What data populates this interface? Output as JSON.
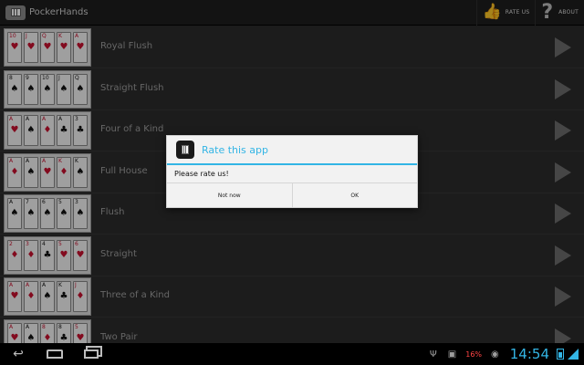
{
  "app": {
    "title": "PockerHands"
  },
  "actionbar": {
    "rate_label": "RATE US",
    "about_label": "ABOUT"
  },
  "hands": [
    {
      "label": "Royal Flush",
      "cards": [
        [
          "10",
          "♥",
          "red"
        ],
        [
          "J",
          "♥",
          "red"
        ],
        [
          "Q",
          "♥",
          "red"
        ],
        [
          "K",
          "♥",
          "red"
        ],
        [
          "A",
          "♥",
          "red"
        ]
      ]
    },
    {
      "label": "Straight Flush",
      "cards": [
        [
          "8",
          "♠",
          "blk"
        ],
        [
          "9",
          "♠",
          "blk"
        ],
        [
          "10",
          "♠",
          "blk"
        ],
        [
          "J",
          "♠",
          "blk"
        ],
        [
          "Q",
          "♠",
          "blk"
        ]
      ]
    },
    {
      "label": "Four of a Kind",
      "cards": [
        [
          "A",
          "♥",
          "red"
        ],
        [
          "A",
          "♠",
          "blk"
        ],
        [
          "A",
          "♦",
          "red"
        ],
        [
          "A",
          "♣",
          "blk"
        ],
        [
          "3",
          "♣",
          "blk"
        ]
      ]
    },
    {
      "label": "Full House",
      "cards": [
        [
          "A",
          "♦",
          "red"
        ],
        [
          "A",
          "♠",
          "blk"
        ],
        [
          "A",
          "♥",
          "red"
        ],
        [
          "K",
          "♦",
          "red"
        ],
        [
          "K",
          "♠",
          "blk"
        ]
      ]
    },
    {
      "label": "Flush",
      "cards": [
        [
          "A",
          "♠",
          "blk"
        ],
        [
          "7",
          "♠",
          "blk"
        ],
        [
          "6",
          "♠",
          "blk"
        ],
        [
          "5",
          "♠",
          "blk"
        ],
        [
          "3",
          "♠",
          "blk"
        ]
      ]
    },
    {
      "label": "Straight",
      "cards": [
        [
          "2",
          "♦",
          "red"
        ],
        [
          "3",
          "♦",
          "red"
        ],
        [
          "4",
          "♣",
          "blk"
        ],
        [
          "5",
          "♥",
          "red"
        ],
        [
          "6",
          "♥",
          "red"
        ]
      ]
    },
    {
      "label": "Three of a Kind",
      "cards": [
        [
          "A",
          "♥",
          "red"
        ],
        [
          "A",
          "♦",
          "red"
        ],
        [
          "A",
          "♠",
          "blk"
        ],
        [
          "K",
          "♣",
          "blk"
        ],
        [
          "J",
          "♦",
          "red"
        ]
      ]
    },
    {
      "label": "Two Pair",
      "cards": [
        [
          "A",
          "♥",
          "red"
        ],
        [
          "A",
          "♠",
          "blk"
        ],
        [
          "8",
          "♦",
          "red"
        ],
        [
          "8",
          "♣",
          "blk"
        ],
        [
          "5",
          "♥",
          "red"
        ]
      ]
    }
  ],
  "dialog": {
    "title": "Rate this app",
    "message": "Please rate us!",
    "negative": "Not now",
    "positive": "OK"
  },
  "statusbar": {
    "battery_pct": "16%",
    "time": "14:54"
  },
  "colors": {
    "accent": "#33b5e5",
    "background": "#2b2b2b",
    "warning": "#ff4444"
  },
  "icons": [
    "app-icon",
    "thumbs-up-icon",
    "help-icon",
    "play-icon",
    "back-icon",
    "home-icon",
    "recent-apps-icon",
    "usb-icon",
    "image-icon",
    "android-icon",
    "battery-icon",
    "wifi-icon"
  ]
}
